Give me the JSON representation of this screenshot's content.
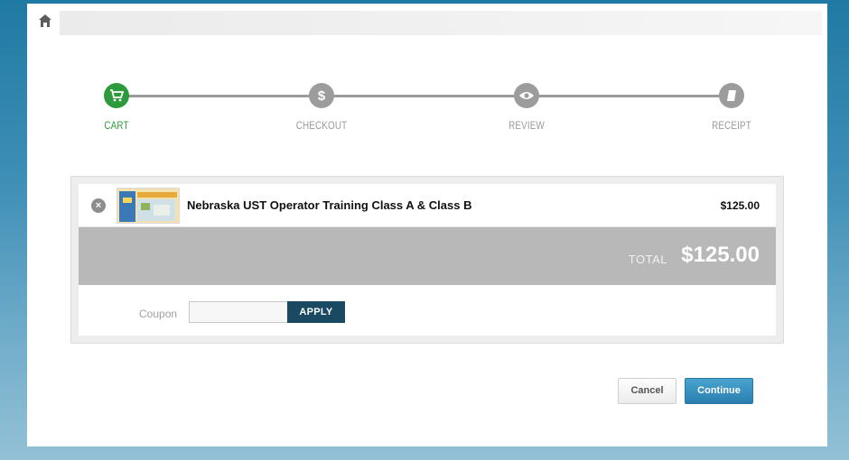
{
  "steps": [
    {
      "label": "CART",
      "icon": "cart-icon",
      "active": true
    },
    {
      "label": "CHECKOUT",
      "icon": "dollar-icon",
      "active": false
    },
    {
      "label": "REVIEW",
      "icon": "eye-icon",
      "active": false
    },
    {
      "label": "RECEIPT",
      "icon": "receipt-icon",
      "active": false
    }
  ],
  "cart": {
    "item_title": "Nebraska UST Operator Training Class A & Class B",
    "item_price": "$125.00",
    "remove_symbol": "×",
    "total_label": "TOTAL",
    "total_value": "$125.00",
    "coupon_label": "Coupon",
    "coupon_value": "",
    "coupon_placeholder": "",
    "apply_label": "APPLY"
  },
  "actions": {
    "cancel_label": "Cancel",
    "continue_label": "Continue"
  },
  "colors": {
    "active_step": "#2d9a3c",
    "inactive_step": "#9c9c9c",
    "apply_button": "#1a4962",
    "continue_button": "#2a7fb0",
    "total_bar": "#b7b8b7"
  }
}
